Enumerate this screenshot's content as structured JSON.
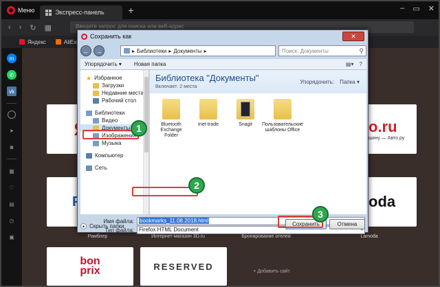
{
  "browser": {
    "menu_label": "Меню",
    "tab_label": "Экспресс-панель",
    "new_tab": "+",
    "address_text": "Введите запрос для поиска или веб-адрес",
    "bookmarks": [
      {
        "label": "Яндекс"
      },
      {
        "label": "AliExpress"
      }
    ]
  },
  "speed_dial": {
    "tiles": [
      {
        "text": "Ян",
        "color": "#d41f26"
      },
      {
        "text": "o.ru",
        "color": "#d41f26",
        "sub": "шину — Авто.ру"
      },
      {
        "text": "Рам",
        "color": "#1e5aa8"
      },
      {
        "text": "oda",
        "color": "#111111"
      },
      {
        "text": "bon prix",
        "color": "#c8102e"
      },
      {
        "text": "RESERVED",
        "color": "#333333"
      }
    ],
    "captions": [
      "Рамблер",
      "Интернет-магазин 3D.ru",
      "Бронирование отелей",
      "Lamoda"
    ],
    "add_site": "+ Добавить сайт"
  },
  "dialog": {
    "title": "Сохранить как",
    "close": "✕",
    "path": [
      "Библиотеки",
      "Документы"
    ],
    "search_placeholder": "Поиск: Документы",
    "organize": "Упорядочить ▾",
    "new_folder": "Новая папка",
    "nav_favorites": "Избранное",
    "nav_items": [
      "Загрузки",
      "Недавние места",
      "Рабочий стол"
    ],
    "nav_libraries": "Библиотеки",
    "lib_items": [
      "Видео",
      "Документы",
      "Изображения",
      "Музыка"
    ],
    "nav_computer": "Компьютер",
    "nav_network": "Сеть",
    "library_title": "Библиотека \"Документы\"",
    "library_sub": "Включает: 2 места",
    "arrange_label": "Упорядочить:",
    "arrange_value": "Папка ▾",
    "files": [
      {
        "name": "Bluetooth Exchange Folder"
      },
      {
        "name": "Inet-trade"
      },
      {
        "name": "Snagit"
      },
      {
        "name": "Пользовательские шаблоны Office"
      }
    ],
    "filename_label": "Имя файла:",
    "filename_value": "bookmarks_11.08.2018.html",
    "filetype_label": "Тип файла:",
    "filetype_value": "Firefox HTML Document",
    "hide_folders": "Скрыть папки",
    "save": "Сохранить",
    "cancel": "Отмена"
  },
  "callouts": [
    "1",
    "2",
    "3"
  ],
  "colors": {
    "callout_badge": "#2fa84f",
    "callout_outline": "#e03a3a",
    "opera_red": "#e0142a"
  }
}
